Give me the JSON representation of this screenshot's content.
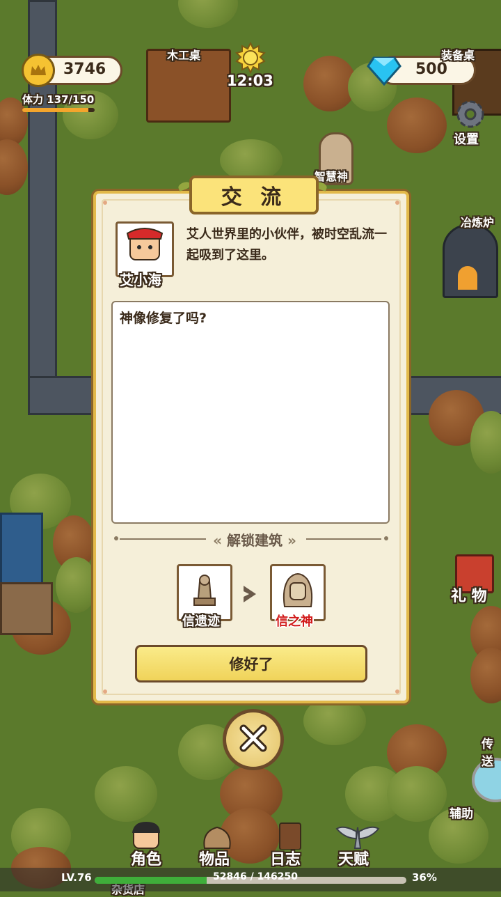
{
  "hud": {
    "gold": "3746",
    "stamina_label": "体力",
    "stamina_value": "137/150",
    "stamina_fraction": 0.913,
    "time": "12:03",
    "diamonds": "500"
  },
  "map_labels": {
    "carpentry": "木工桌",
    "equipment": "装备桌",
    "settings": "设置",
    "wisdom_god": "智慧神",
    "smelter": "冶炼炉",
    "gift": "礼 物",
    "teleport": "传送",
    "assist": "辅助",
    "shop": "杂货店"
  },
  "dialog": {
    "title": "交 流",
    "npc_name": "艾小海",
    "npc_desc": "艾人世界里的小伙伴，被时空乱流一起吸到了这里。",
    "message": "神像修复了吗?",
    "unlock_section": "解锁建筑",
    "unlock_from": "信遗迹",
    "unlock_to": "信之神",
    "confirm_button": "修好了"
  },
  "nav": {
    "character": "角色",
    "items": "物品",
    "log": "日志",
    "talent": "天赋"
  },
  "status": {
    "level": "LV.76",
    "xp": "52846 / 146250",
    "xp_percent": "36%",
    "xp_fraction": 0.36
  },
  "colors": {
    "panel": "#f5efd9",
    "panel_border": "#e2b94a",
    "banner": "#fbe37a",
    "unlock_target_text": "#d11a1a",
    "xp_fill": "#3fae3a"
  },
  "icons": [
    "crown-icon",
    "sun-icon",
    "diamond-icon",
    "gear-icon",
    "close-icon",
    "arrow-right-icon"
  ]
}
